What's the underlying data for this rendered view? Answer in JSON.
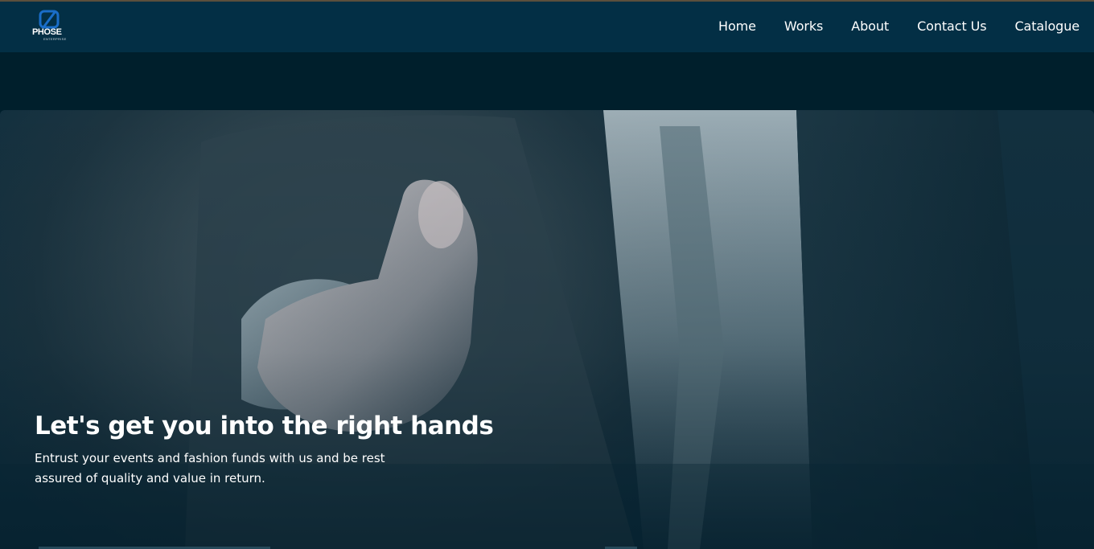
{
  "brand": {
    "name": "PHOSE",
    "subtitle": "ENTERPRISE",
    "icon": "phose-logo-icon",
    "accent_color": "#1a6dc8"
  },
  "nav": {
    "items": [
      {
        "label": "Home"
      },
      {
        "label": "Works"
      },
      {
        "label": "About"
      },
      {
        "label": "Contact Us"
      },
      {
        "label": "Catalogue"
      }
    ],
    "background": "#032f45"
  },
  "hero": {
    "title": "Let's get you into the right hands",
    "text": "Entrust your events and fashion funds with us and be rest assured of quality and value in return.",
    "image": "handshake-offer-image"
  }
}
